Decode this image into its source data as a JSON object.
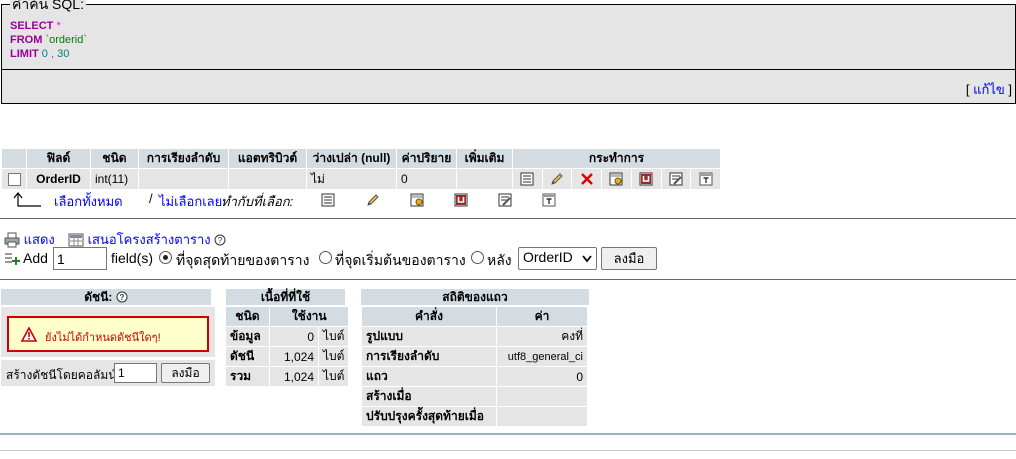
{
  "sql_query": {
    "legend": "คำค้น SQL:",
    "line1_kw": "SELECT",
    "line1_rest": "*",
    "line2_kw": "FROM",
    "line2_rest": "`orderid`",
    "line3_kw": "LIMIT",
    "line3_num1": "0",
    "line3_sep": ",",
    "line3_num2": "30",
    "edit_open": "[",
    "edit_label": "แก้ไข",
    "edit_close": "]"
  },
  "structure": {
    "headers": [
      "ฟิลด์",
      "ชนิด",
      "การเรียงลำดับ",
      "แอตทริบิวต์",
      "ว่างเปล่า (null)",
      "ค่าปริยาย",
      "เพิ่มเติม",
      "กระทำการ"
    ],
    "rows": [
      {
        "field": "OrderID",
        "type": "int(11)",
        "collation": "",
        "attributes": "",
        "null": "ไม่",
        "default": "0",
        "extra": ""
      }
    ],
    "actions": [
      "browse-distinct",
      "edit",
      "drop",
      "primary",
      "unique",
      "index",
      "fulltext"
    ]
  },
  "with_selected": {
    "check_all": "เลือกทั้งหมด",
    "separator": "/",
    "uncheck_all": "ไม่เลือกเลย",
    "label": "ทำกับที่เลือก:"
  },
  "links": {
    "print_view": "แสดง",
    "propose_structure": "เสนอโครงสร้างตาราง"
  },
  "add_fields": {
    "add_label": "Add",
    "count": "1",
    "fields_label": "field(s)",
    "at_end": "ที่จุดสุดท้ายของตาราง",
    "at_beginning": "ที่จุดเริ่มต้นของตาราง",
    "after": "หลัง",
    "after_column": "OrderID",
    "go": "ลงมือ"
  },
  "indexes": {
    "title": "ดัชนี:",
    "warning": "ยังไม่ได้กำหนดดัชนีใดๆ!",
    "create_label": "สร้างดัชนีโดยคอลัมน์",
    "create_count": "1",
    "go": "ลงมือ"
  },
  "space_usage": {
    "title": "เนื้อที่ที่ใช้",
    "col_type": "ชนิด",
    "col_usage": "ใช้งาน",
    "rows": [
      {
        "label": "ข้อมูล",
        "value": "0",
        "unit": "ไบต์"
      },
      {
        "label": "ดัชนี",
        "value": "1,024",
        "unit": "ไบต์"
      },
      {
        "label": "รวม",
        "value": "1,024",
        "unit": "ไบต์"
      }
    ]
  },
  "row_stats": {
    "title": "สถิติของแถว",
    "col_statement": "คำสั่ง",
    "col_value": "ค่า",
    "rows": [
      {
        "label": "รูปแบบ",
        "value": "คงที่"
      },
      {
        "label": "การเรียงลำดับ",
        "value": "utf8_general_ci"
      },
      {
        "label": "แถว",
        "value": "0"
      },
      {
        "label": "สร้างเมื่อ",
        "value": ""
      },
      {
        "label": "ปรับปรุงครั้งสุดท้ายเมื่อ",
        "value": ""
      }
    ]
  }
}
